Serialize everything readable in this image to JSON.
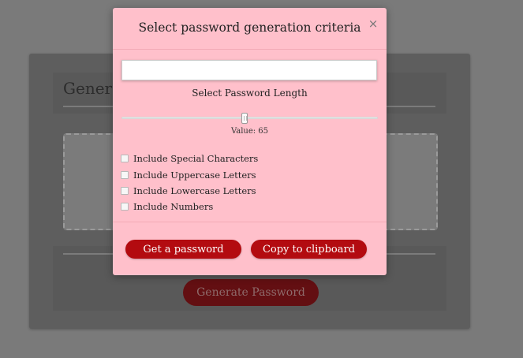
{
  "background": {
    "title": "Genera",
    "generate_button_label": "Generate Password"
  },
  "modal": {
    "title": "Select password generation criteria",
    "close_glyph": "×",
    "password_field": {
      "value": "",
      "placeholder": ""
    },
    "length_label": "Select Password Length",
    "slider": {
      "value": 65,
      "fraction": 0.48,
      "value_text": "Value: 65"
    },
    "criteria": [
      {
        "label": "Include Special Characters",
        "checked": false
      },
      {
        "label": "Include Uppercase Letters",
        "checked": false
      },
      {
        "label": "Include Lowercase Letters",
        "checked": false
      },
      {
        "label": "Include Numbers",
        "checked": false
      }
    ],
    "get_password_label": "Get a password",
    "copy_label": "Copy to clipboard"
  },
  "colors": {
    "modal_background": "#ffc0cb",
    "button_red": "#b30b10",
    "overlay": "#7a7a7a"
  },
  "icons": {
    "close": "close-icon",
    "checkbox": "checkbox-icon"
  }
}
